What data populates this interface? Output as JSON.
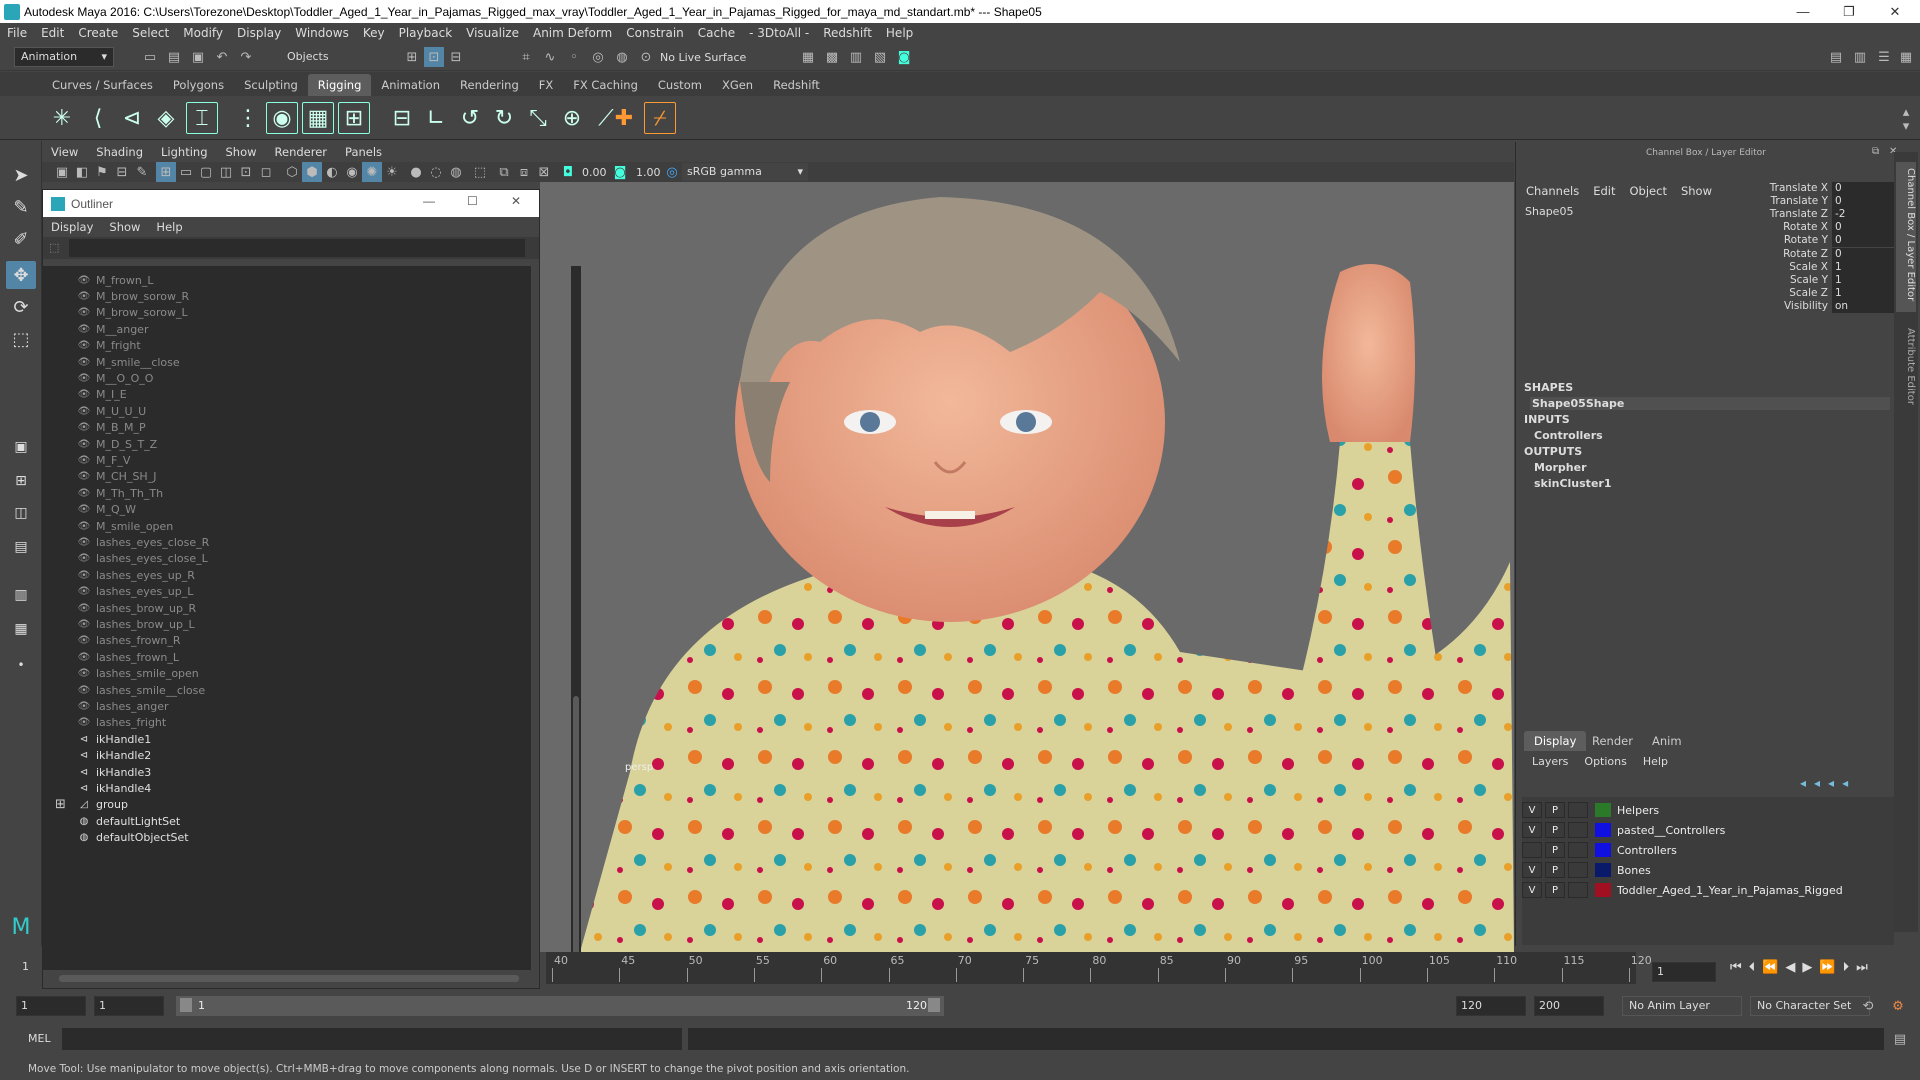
{
  "window": {
    "title": "Autodesk Maya 2016: C:\\Users\\Torezone\\Desktop\\Toddler_Aged_1_Year_in_Pajamas_Rigged_max_vray\\Toddler_Aged_1_Year_in_Pajamas_Rigged_for_maya_md_standart.mb*  ---  Shape05",
    "minimize": "—",
    "maximize": "❐",
    "close": "✕"
  },
  "menubar": [
    "File",
    "Edit",
    "Create",
    "Select",
    "Modify",
    "Display",
    "Windows",
    "Key",
    "Playback",
    "Visualize",
    "Anim Deform",
    "Constrain",
    "Cache",
    "- 3DtoAll -",
    "Redshift",
    "Help"
  ],
  "statusline": {
    "mode": "Animation",
    "select_mode": "Objects",
    "live_surface": "No Live Surface"
  },
  "shelf_tabs": [
    {
      "label": "Curves / Surfaces",
      "active": false
    },
    {
      "label": "Polygons",
      "active": false
    },
    {
      "label": "Sculpting",
      "active": false
    },
    {
      "label": "Rigging",
      "active": true
    },
    {
      "label": "Animation",
      "active": false
    },
    {
      "label": "Rendering",
      "active": false
    },
    {
      "label": "FX",
      "active": false
    },
    {
      "label": "FX Caching",
      "active": false
    },
    {
      "label": "Custom",
      "active": false
    },
    {
      "label": "XGen",
      "active": false
    },
    {
      "label": "Redshift",
      "active": false
    }
  ],
  "panel_menu": [
    "View",
    "Shading",
    "Lighting",
    "Show",
    "Renderer",
    "Panels"
  ],
  "panel_toolbar": {
    "near_value": "0.00",
    "far_value": "1.00",
    "color_space": "sRGB gamma"
  },
  "viewport": {
    "camera_label": "persp"
  },
  "outliner": {
    "title": "Outliner",
    "menu": [
      "Display",
      "Show",
      "Help"
    ],
    "items": [
      {
        "label": "M_frown_L",
        "kind": "blend",
        "dim": true
      },
      {
        "label": "M_brow_sorow_R",
        "kind": "blend",
        "dim": true
      },
      {
        "label": "M_brow_sorow_L",
        "kind": "blend",
        "dim": true
      },
      {
        "label": "M__anger",
        "kind": "blend",
        "dim": true
      },
      {
        "label": "M_fright",
        "kind": "blend",
        "dim": true
      },
      {
        "label": "M_smile__close",
        "kind": "blend",
        "dim": true
      },
      {
        "label": "M__O_O_O",
        "kind": "blend",
        "dim": true
      },
      {
        "label": "M_I_E",
        "kind": "blend",
        "dim": true
      },
      {
        "label": "M_U_U_U",
        "kind": "blend",
        "dim": true
      },
      {
        "label": "M_B_M_P",
        "kind": "blend",
        "dim": true
      },
      {
        "label": "M_D_S_T_Z",
        "kind": "blend",
        "dim": true
      },
      {
        "label": "M_F_V",
        "kind": "blend",
        "dim": true
      },
      {
        "label": "M_CH_SH_J",
        "kind": "blend",
        "dim": true
      },
      {
        "label": "M_Th_Th_Th",
        "kind": "blend",
        "dim": true
      },
      {
        "label": "M_Q_W",
        "kind": "blend",
        "dim": true
      },
      {
        "label": "M_smile_open",
        "kind": "blend",
        "dim": true
      },
      {
        "label": "lashes_eyes_close_R",
        "kind": "blend",
        "dim": true
      },
      {
        "label": "lashes_eyes_close_L",
        "kind": "blend",
        "dim": true
      },
      {
        "label": "lashes_eyes_up_R",
        "kind": "blend",
        "dim": true
      },
      {
        "label": "lashes_eyes_up_L",
        "kind": "blend",
        "dim": true
      },
      {
        "label": "lashes_brow_up_R",
        "kind": "blend",
        "dim": true
      },
      {
        "label": "lashes_brow_up_L",
        "kind": "blend",
        "dim": true
      },
      {
        "label": "lashes_frown_R",
        "kind": "blend",
        "dim": true
      },
      {
        "label": "lashes_frown_L",
        "kind": "blend",
        "dim": true
      },
      {
        "label": "lashes_smile_open",
        "kind": "blend",
        "dim": true
      },
      {
        "label": "lashes_smile__close",
        "kind": "blend",
        "dim": true
      },
      {
        "label": "lashes_anger",
        "kind": "blend",
        "dim": true
      },
      {
        "label": "lashes_fright",
        "kind": "blend",
        "dim": true
      },
      {
        "label": "ikHandle1",
        "kind": "ik",
        "dim": false
      },
      {
        "label": "ikHandle2",
        "kind": "ik",
        "dim": false
      },
      {
        "label": "ikHandle3",
        "kind": "ik",
        "dim": false
      },
      {
        "label": "ikHandle4",
        "kind": "ik",
        "dim": false
      },
      {
        "label": "group",
        "kind": "group",
        "dim": false,
        "expandable": true
      },
      {
        "label": "defaultLightSet",
        "kind": "set",
        "dim": false
      },
      {
        "label": "defaultObjectSet",
        "kind": "set",
        "dim": false
      }
    ]
  },
  "channel_box": {
    "header": "Channel Box / Layer Editor",
    "menu": [
      "Channels",
      "Edit",
      "Object",
      "Show"
    ],
    "object": "Shape05",
    "channels": [
      {
        "name": "Translate X",
        "value": "0"
      },
      {
        "name": "Translate Y",
        "value": "0"
      },
      {
        "name": "Translate Z",
        "value": "-2"
      },
      {
        "name": "Rotate X",
        "value": "0"
      },
      {
        "name": "Rotate Y",
        "value": "0"
      },
      {
        "name": "Rotate Z",
        "value": "0"
      },
      {
        "name": "Scale X",
        "value": "1"
      },
      {
        "name": "Scale Y",
        "value": "1"
      },
      {
        "name": "Scale Z",
        "value": "1"
      },
      {
        "name": "Visibility",
        "value": "on"
      }
    ],
    "shapes_heading": "SHAPES",
    "shapes": [
      "Shape05Shape"
    ],
    "inputs_heading": "INPUTS",
    "inputs": [
      "Controllers"
    ],
    "outputs_heading": "OUTPUTS",
    "outputs": [
      "Morpher",
      "skinCluster1"
    ],
    "side_tabs": [
      "Channel Box / Layer Editor",
      "Attribute Editor"
    ]
  },
  "layer_editor": {
    "tabs": [
      {
        "label": "Display",
        "active": true
      },
      {
        "label": "Render",
        "active": false
      },
      {
        "label": "Anim",
        "active": false
      }
    ],
    "menu": [
      "Layers",
      "Options",
      "Help"
    ],
    "layers": [
      {
        "v": "V",
        "p": "P",
        "color": "#2a7a2a",
        "name": "Helpers"
      },
      {
        "v": "V",
        "p": "P",
        "color": "#1010e0",
        "name": "pasted__Controllers"
      },
      {
        "v": "",
        "p": "P",
        "color": "#1010e0",
        "name": "Controllers"
      },
      {
        "v": "V",
        "p": "P",
        "color": "#0a1a6a",
        "name": "Bones"
      },
      {
        "v": "V",
        "p": "P",
        "color": "#a01020",
        "name": "Toddler_Aged_1_Year_in_Pajamas_Rigged"
      }
    ]
  },
  "timeline": {
    "ticks": [
      "40",
      "45",
      "50",
      "55",
      "60",
      "65",
      "70",
      "75",
      "80",
      "85",
      "90",
      "95",
      "100",
      "105",
      "110",
      "115",
      "120"
    ],
    "current_frame": "1",
    "left_frame": "1"
  },
  "range": {
    "start": "1",
    "playback_start": "1",
    "slider_start": "1",
    "slider_end": "120",
    "playback_end": "120",
    "end": "200",
    "anim_layer": "No Anim Layer",
    "character_set": "No Character Set"
  },
  "command_line": {
    "label": "MEL"
  },
  "help_line": "Move Tool: Use manipulator to move object(s). Ctrl+MMB+drag to move components along normals. Use D or INSERT to change the pivot position and axis orientation."
}
